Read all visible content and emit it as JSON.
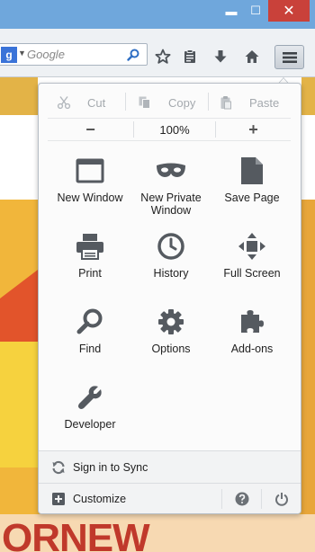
{
  "window": {
    "minimize_glyph": "▬",
    "maximize_glyph": "☐",
    "close_glyph": "✕"
  },
  "toolbar": {
    "search": {
      "engine_letter": "g",
      "placeholder": "Google"
    },
    "buttons": [
      "bookmark-star-icon",
      "reading-list-icon",
      "downloads-icon",
      "home-icon",
      "menu-icon"
    ]
  },
  "menu": {
    "edit": {
      "cut": "Cut",
      "copy": "Copy",
      "paste": "Paste"
    },
    "zoom": {
      "minus": "−",
      "level": "100%",
      "plus": "+"
    },
    "items": [
      {
        "label": "New Window",
        "icon": "new-window-icon"
      },
      {
        "label": "New Private Window",
        "label_line1": "New Private",
        "label_line2": "Window",
        "icon": "private-mask-icon"
      },
      {
        "label": "Save Page",
        "icon": "save-page-icon"
      },
      {
        "label": "Print",
        "icon": "printer-icon"
      },
      {
        "label": "History",
        "icon": "history-clock-icon"
      },
      {
        "label": "Full Screen",
        "icon": "fullscreen-arrows-icon"
      },
      {
        "label": "Find",
        "icon": "magnifier-icon"
      },
      {
        "label": "Options",
        "icon": "gear-icon"
      },
      {
        "label": "Add-ons",
        "icon": "puzzle-piece-icon"
      },
      {
        "label": "Developer",
        "icon": "wrench-icon"
      }
    ],
    "sync_label": "Sign in to Sync",
    "customize_label": "Customize"
  },
  "background": {
    "banner_text": "ORNEW"
  },
  "colors": {
    "titlebar": "#6fa7dc",
    "close_button": "#c9413a",
    "toolbar": "#eef1f4",
    "icon_gray": "#555a60",
    "page_accent": "#f1b63b"
  }
}
